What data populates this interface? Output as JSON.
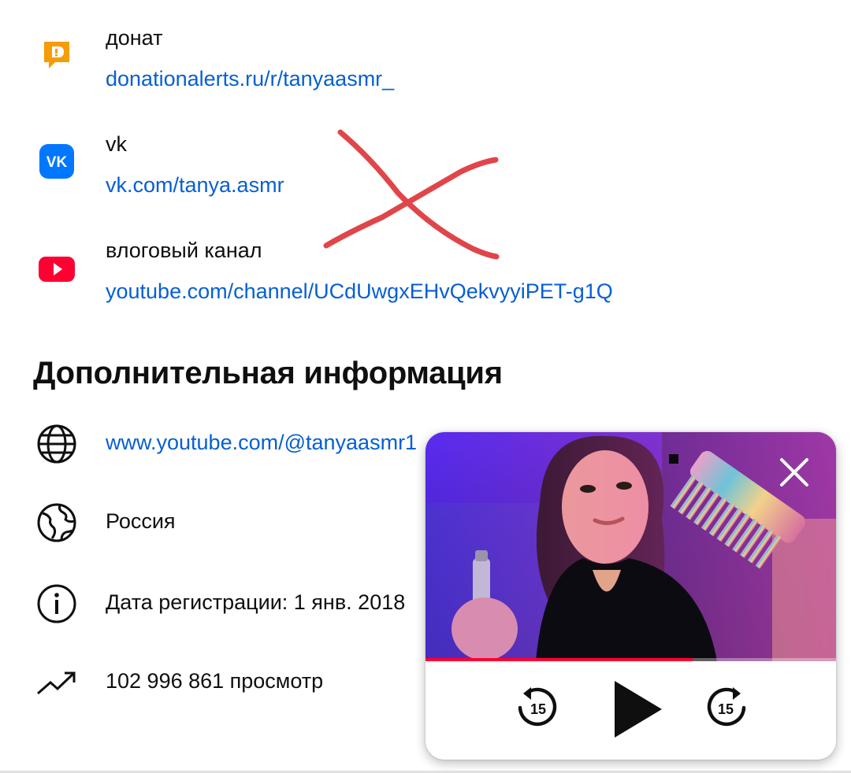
{
  "links": [
    {
      "title": "донат",
      "url": "donationalerts.ru/r/tanyaasmr_",
      "icon": "donationalerts-icon"
    },
    {
      "title": "vk",
      "url": "vk.com/tanya.asmr",
      "icon": "vk-icon"
    },
    {
      "title": "влоговый канал",
      "url": "youtube.com/channel/UCdUwgxEHvQekvyyiPET-g1Q",
      "icon": "youtube-icon"
    }
  ],
  "details": {
    "title": "Дополнительная информация",
    "items": [
      {
        "text": "www.youtube.com/@tanyaasmr1",
        "icon": "globe-icon"
      },
      {
        "text": "Россия",
        "icon": "earth-icon"
      },
      {
        "text": "Дата регистрации: 1 янв. 2018",
        "icon": "info-icon"
      },
      {
        "text": "102 996 861 просмотр",
        "icon": "trending-icon"
      }
    ]
  },
  "mini_player": {
    "progress": 0.65,
    "rewind_seconds": "15",
    "forward_seconds": "15"
  },
  "colors": {
    "link": "#065fd4",
    "progress": "#ff0033",
    "annotation": "#e0454a",
    "donationalerts": "#f59c07",
    "vk": "#0077ff",
    "youtube": "#ff0033"
  }
}
